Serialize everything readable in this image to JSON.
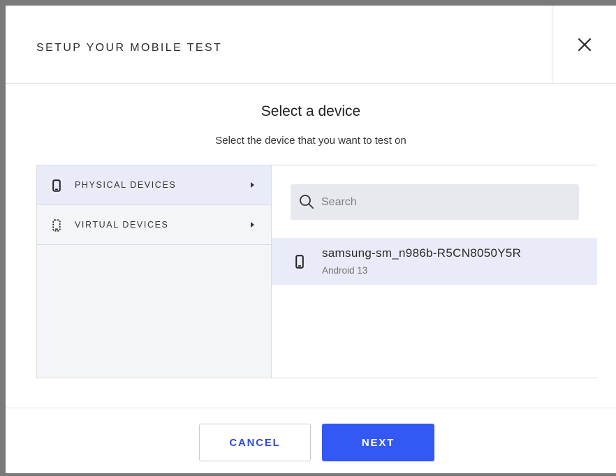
{
  "header": {
    "title": "SETUP YOUR MOBILE TEST",
    "close_icon": "close-icon"
  },
  "body": {
    "title": "Select a device",
    "subtitle": "Select the device that you want to test on"
  },
  "categories": [
    {
      "label": "PHYSICAL DEVICES",
      "icon": "phone-icon",
      "active": true
    },
    {
      "label": "VIRTUAL DEVICES",
      "icon": "virtual-phone-icon",
      "active": false
    }
  ],
  "search": {
    "placeholder": "Search",
    "value": ""
  },
  "devices": [
    {
      "name": "samsung-sm_n986b-R5CN8050Y5R",
      "os": "Android 13",
      "icon": "phone-icon",
      "selected": true
    }
  ],
  "footer": {
    "cancel_label": "CANCEL",
    "next_label": "NEXT"
  },
  "colors": {
    "accent": "#3358f4",
    "selected_bg": "#e9ecf8",
    "sidebar_bg": "#f4f5f9",
    "search_bg": "#e8e9ee"
  }
}
